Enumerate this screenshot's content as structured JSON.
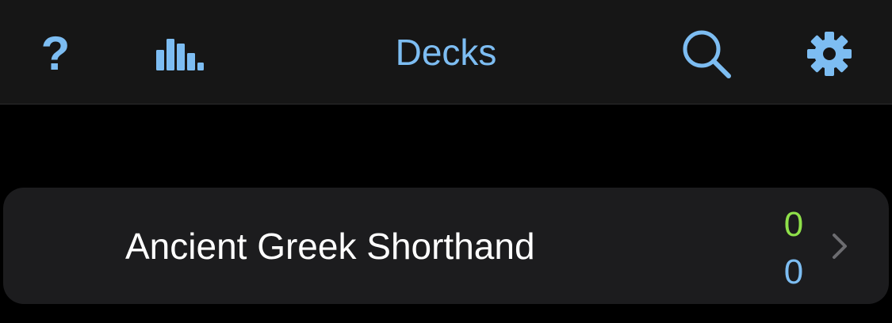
{
  "theme": {
    "accent": "#7dbdf2",
    "new_count_color": "#8fe04a",
    "review_count_color": "#7dbdf2",
    "chevron_color": "#6c6c70"
  },
  "navbar": {
    "title": "Decks",
    "help_icon": "question-mark-icon",
    "help_glyph": "?",
    "stats_icon": "bar-chart-icon",
    "search_icon": "search-icon",
    "settings_icon": "gear-icon"
  },
  "decks": [
    {
      "name": "Ancient Greek Shorthand",
      "new_count": "0",
      "review_count": "0",
      "chevron_icon": "chevron-right-icon"
    }
  ]
}
